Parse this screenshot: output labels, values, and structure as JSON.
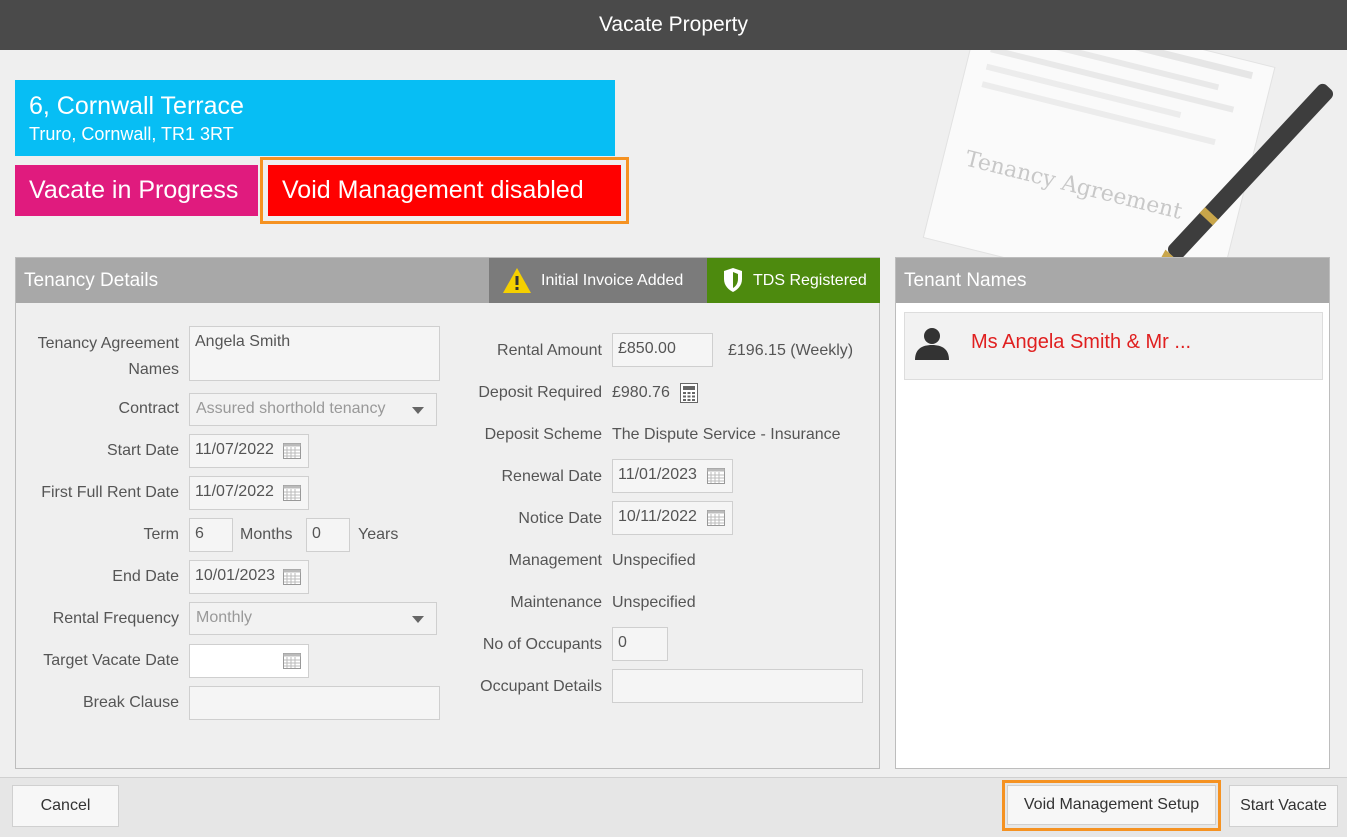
{
  "window": {
    "title": "Vacate Property"
  },
  "background_art": {
    "text": "Tenancy Agreement"
  },
  "property": {
    "line1": "6, Cornwall Terrace",
    "line2": "Truro, Cornwall, TR1 3RT"
  },
  "status": {
    "vacate": "Vacate in Progress",
    "void": "Void Management disabled"
  },
  "tenancy": {
    "title": "Tenancy Details",
    "badges": {
      "invoice": "Initial Invoice Added",
      "tds": "TDS Registered"
    },
    "labels": {
      "agreement_names_1": "Tenancy Agreement",
      "agreement_names_2": "Names",
      "contract": "Contract",
      "start_date": "Start Date",
      "first_full_rent": "First Full Rent Date",
      "term": "Term",
      "months": "Months",
      "years": "Years",
      "end_date": "End Date",
      "rental_frequency": "Rental Frequency",
      "target_vacate": "Target Vacate Date",
      "break_clause": "Break Clause",
      "rental_amount": "Rental Amount",
      "deposit_required": "Deposit Required",
      "deposit_scheme": "Deposit Scheme",
      "renewal_date": "Renewal Date",
      "notice_date": "Notice Date",
      "management": "Management",
      "maintenance": "Maintenance",
      "occupants": "No of Occupants",
      "occupant_details": "Occupant Details"
    },
    "values": {
      "agreement_names": "Angela Smith",
      "contract": "Assured shorthold tenancy",
      "start_date": "11/07/2022",
      "first_full_rent": "11/07/2022",
      "term_months": "6",
      "term_years": "0",
      "end_date": "10/01/2023",
      "rental_frequency": "Monthly",
      "target_vacate": "",
      "break_clause": "",
      "rental_amount": "£850.00",
      "rental_weekly": "£196.15 (Weekly)",
      "deposit_required": "£980.76",
      "deposit_scheme": "The Dispute Service - Insurance",
      "renewal_date": "11/01/2023",
      "notice_date": "10/11/2022",
      "management": "Unspecified",
      "maintenance": "Unspecified",
      "occupants": "0",
      "occupant_details": ""
    }
  },
  "tenants": {
    "title": "Tenant Names",
    "items": [
      {
        "name": "Ms Angela Smith & Mr ..."
      }
    ]
  },
  "footer": {
    "cancel": "Cancel",
    "void_setup": "Void Management Setup",
    "start_vacate": "Start Vacate"
  }
}
